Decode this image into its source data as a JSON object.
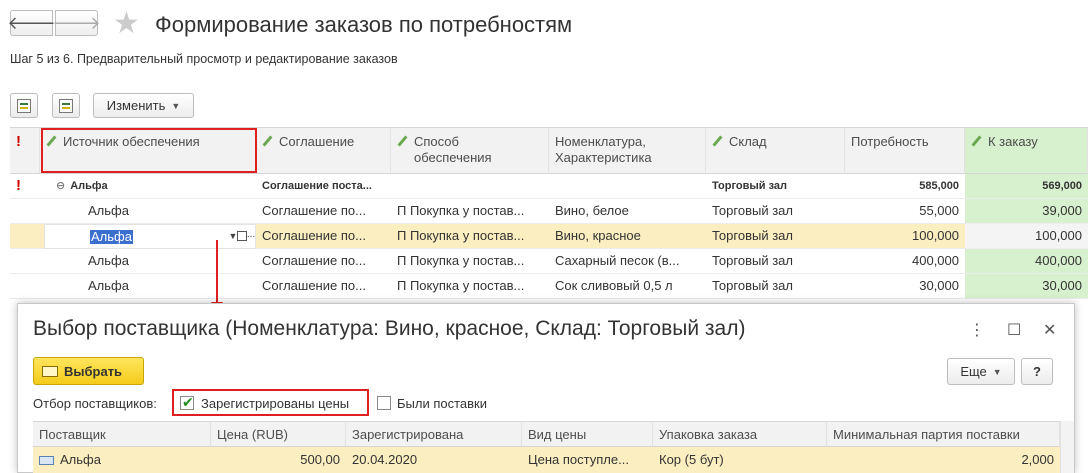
{
  "window": {
    "title": "Формирование заказов по потребностям",
    "step": "Шаг 5 из 6. Предварительный просмотр и редактирование заказов"
  },
  "toolbar": {
    "change_label": "Изменить"
  },
  "grid": {
    "columns": [
      "Источник обеспечения",
      "Соглашение",
      "Способ обеспечения",
      "Номенклатура, Характеристика",
      "Склад",
      "Потребность",
      "К заказу"
    ],
    "group_row": {
      "source": "Альфа",
      "agreement": "Соглашение поста...",
      "warehouse": "Торговый зал",
      "need": "585,000",
      "to_order": "569,000"
    },
    "rows": [
      {
        "source": "Альфа",
        "agreement": "Соглашение по...",
        "method": "П Покупка у постав...",
        "item": "Вино, белое",
        "warehouse": "Торговый зал",
        "need": "55,000",
        "to_order": "39,000"
      },
      {
        "source": "Альфа",
        "agreement": "Соглашение по...",
        "method": "П Покупка у постав...",
        "item": "Вино, красное",
        "warehouse": "Торговый зал",
        "need": "100,000",
        "to_order": "100,000"
      },
      {
        "source": "Альфа",
        "agreement": "Соглашение по...",
        "method": "П Покупка у постав...",
        "item": "Сахарный песок (в...",
        "warehouse": "Торговый зал",
        "need": "400,000",
        "to_order": "400,000"
      },
      {
        "source": "Альфа",
        "agreement": "Соглашение по...",
        "method": "П Покупка у постав...",
        "item": "Сок сливовый 0,5 л",
        "warehouse": "Торговый зал",
        "need": "30,000",
        "to_order": "30,000"
      }
    ]
  },
  "dialog": {
    "title": "Выбор поставщика (Номенклатура: Вино, красное, Склад: Торговый зал)",
    "select_label": "Выбрать",
    "more_label": "Еще",
    "help_label": "?",
    "filter_label": "Отбор поставщиков:",
    "filter_registered": "Зарегистрированы цены",
    "filter_delivered": "Были поставки",
    "columns": [
      "Поставщик",
      "Цена (RUB)",
      "Зарегистрирована",
      "Вид цены",
      "Упаковка заказа",
      "Минимальная партия поставки"
    ],
    "row": {
      "supplier": "Альфа",
      "price": "500,00",
      "registered": "20.04.2020",
      "price_type": "Цена поступле...",
      "package": "Кор (5 бут)",
      "min_batch": "2,000"
    }
  },
  "colors": {
    "accent_yellow": "#f4cc1b",
    "highlight_red": "#e02020",
    "order_green": "#d7f0cd",
    "selected_row": "#fbeec0"
  }
}
